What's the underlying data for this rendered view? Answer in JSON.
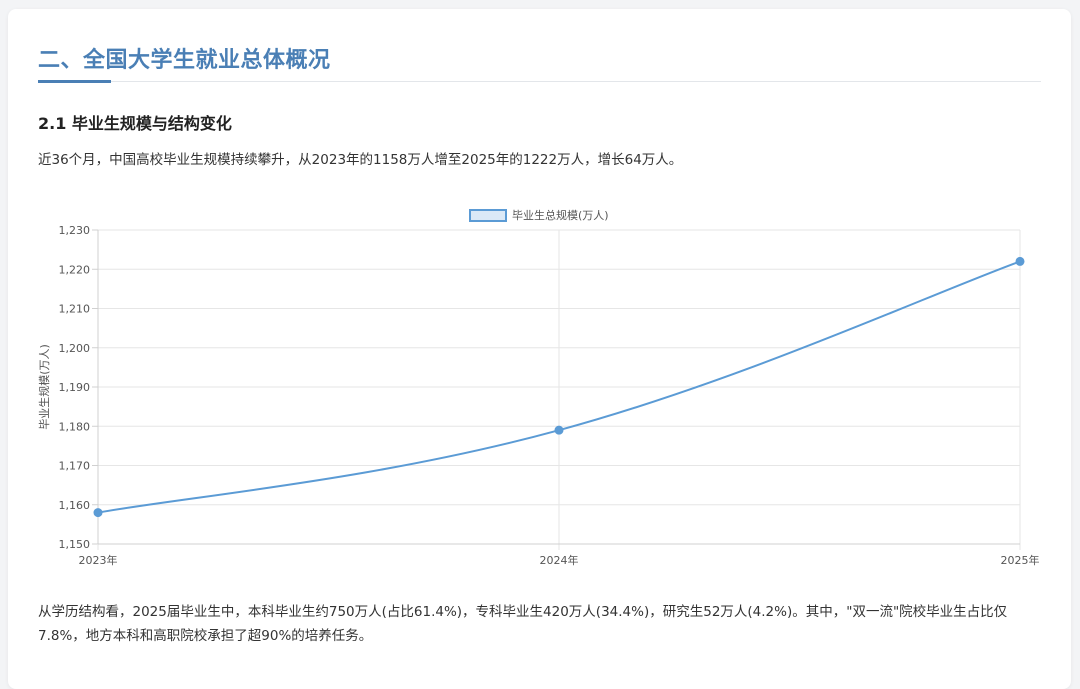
{
  "section": {
    "title": "二、全国大学生就业总体概况",
    "subtitle": "2.1 毕业生规模与结构变化",
    "intro": "近36个月，中国高校毕业生规模持续攀升，从2023年的1158万人增至2025年的1222万人，增长64万人。",
    "structure": "从学历结构看，2025届毕业生中，本科毕业生约750万人(占比61.4%)，专科毕业生420万人(34.4%)，研究生52万人(4.2%)。其中，\"双一流\"院校毕业生占比仅7.8%，地方本科和高职院校承担了超90%的培养任务。"
  },
  "colors": {
    "accent": "#4a7fb5",
    "line": "#5b9bd5",
    "legend_fill": "#dbe9f7"
  },
  "chart_data": {
    "type": "line",
    "title": "",
    "xlabel": "",
    "ylabel": "毕业生规模(万人)",
    "categories": [
      "2023年",
      "2024年",
      "2025年"
    ],
    "series": [
      {
        "name": "毕业生总规模(万人)",
        "values": [
          1158,
          1179,
          1222
        ]
      }
    ],
    "ylim": [
      1150,
      1230
    ],
    "yticks": [
      "1,150",
      "1,160",
      "1,170",
      "1,180",
      "1,190",
      "1,200",
      "1,210",
      "1,220",
      "1,230"
    ],
    "ytick_values": [
      1150,
      1160,
      1170,
      1180,
      1190,
      1200,
      1210,
      1220,
      1230
    ],
    "grid": true,
    "legend": "top-center"
  }
}
